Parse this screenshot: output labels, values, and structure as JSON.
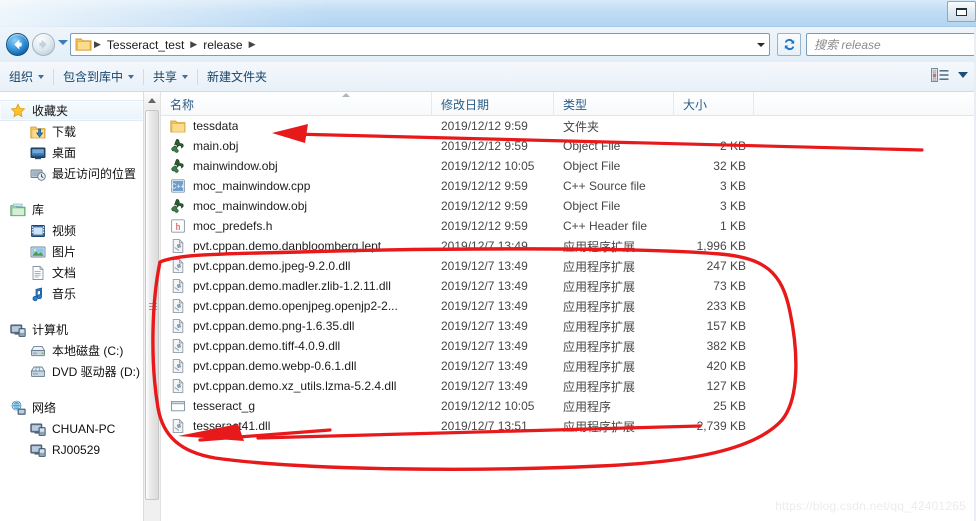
{
  "window": {
    "minimize_button_label": "",
    "restore_glyph": "restore-icon"
  },
  "navigation": {
    "back_label": "后退",
    "forward_label": "前进",
    "recent_pages_label": "最近的页面",
    "refresh_label": "刷新",
    "address_dropdown_label": "▼",
    "breadcrumbs": [
      {
        "label": "Tesseract_test"
      },
      {
        "label": "release"
      }
    ],
    "separator": "▶"
  },
  "search": {
    "placeholder": "搜索 release",
    "value": ""
  },
  "command_bar": {
    "items": [
      {
        "label": "组织",
        "has_caret": true
      },
      {
        "label": "包含到库中",
        "has_caret": true
      },
      {
        "label": "共享",
        "has_caret": true
      },
      {
        "label": "新建文件夹",
        "has_caret": false
      }
    ],
    "view_button_label": "更改您的视图",
    "help_label": ""
  },
  "sidebar": {
    "groups": [
      {
        "root": {
          "label": "收藏夹",
          "icon": "star-icon",
          "selected": true
        },
        "children": [
          {
            "label": "下载",
            "icon": "download-folder-icon"
          },
          {
            "label": "桌面",
            "icon": "desktop-icon"
          },
          {
            "label": "最近访问的位置",
            "icon": "recent-places-icon"
          }
        ]
      },
      {
        "root": {
          "label": "库",
          "icon": "library-icon",
          "selected": false
        },
        "children": [
          {
            "label": "视频",
            "icon": "video-icon"
          },
          {
            "label": "图片",
            "icon": "picture-icon"
          },
          {
            "label": "文档",
            "icon": "document-icon"
          },
          {
            "label": "音乐",
            "icon": "music-icon"
          }
        ]
      },
      {
        "root": {
          "label": "计算机",
          "icon": "computer-icon",
          "selected": false
        },
        "children": [
          {
            "label": "本地磁盘 (C:)",
            "icon": "hard-disk-icon"
          },
          {
            "label": "DVD 驱动器 (D:)",
            "icon": "dvd-drive-icon"
          }
        ]
      },
      {
        "root": {
          "label": "网络",
          "icon": "network-icon",
          "selected": false
        },
        "children": [
          {
            "label": "CHUAN-PC",
            "icon": "computer-icon"
          },
          {
            "label": "RJ00529",
            "icon": "computer-icon"
          }
        ]
      }
    ]
  },
  "file_list": {
    "columns": [
      {
        "key": "name",
        "label": "名称",
        "sorted": true
      },
      {
        "key": "date",
        "label": "修改日期",
        "sorted": false
      },
      {
        "key": "type",
        "label": "类型",
        "sorted": false
      },
      {
        "key": "size",
        "label": "大小",
        "sorted": false
      }
    ],
    "rows": [
      {
        "name": "tessdata",
        "date": "2019/12/12 9:59",
        "type": "文件夹",
        "size": "",
        "icon": "folder-icon"
      },
      {
        "name": "main.obj",
        "date": "2019/12/12 9:59",
        "type": "Object File",
        "size": "2 KB",
        "icon": "obj-file-icon"
      },
      {
        "name": "mainwindow.obj",
        "date": "2019/12/12 10:05",
        "type": "Object File",
        "size": "32 KB",
        "icon": "obj-file-icon"
      },
      {
        "name": "moc_mainwindow.cpp",
        "date": "2019/12/12 9:59",
        "type": "C++ Source file",
        "size": "3 KB",
        "icon": "cpp-source-icon"
      },
      {
        "name": "moc_mainwindow.obj",
        "date": "2019/12/12 9:59",
        "type": "Object File",
        "size": "3 KB",
        "icon": "obj-file-icon"
      },
      {
        "name": "moc_predefs.h",
        "date": "2019/12/12 9:59",
        "type": "C++ Header file",
        "size": "1 KB",
        "icon": "header-file-icon"
      },
      {
        "name": "pvt.cppan.demo.danbloomberg.lept...",
        "date": "2019/12/7 13:49",
        "type": "应用程序扩展",
        "size": "1,996 KB",
        "icon": "dll-icon"
      },
      {
        "name": "pvt.cppan.demo.jpeg-9.2.0.dll",
        "date": "2019/12/7 13:49",
        "type": "应用程序扩展",
        "size": "247 KB",
        "icon": "dll-icon"
      },
      {
        "name": "pvt.cppan.demo.madler.zlib-1.2.11.dll",
        "date": "2019/12/7 13:49",
        "type": "应用程序扩展",
        "size": "73 KB",
        "icon": "dll-icon"
      },
      {
        "name": "pvt.cppan.demo.openjpeg.openjp2-2...",
        "date": "2019/12/7 13:49",
        "type": "应用程序扩展",
        "size": "233 KB",
        "icon": "dll-icon"
      },
      {
        "name": "pvt.cppan.demo.png-1.6.35.dll",
        "date": "2019/12/7 13:49",
        "type": "应用程序扩展",
        "size": "157 KB",
        "icon": "dll-icon"
      },
      {
        "name": "pvt.cppan.demo.tiff-4.0.9.dll",
        "date": "2019/12/7 13:49",
        "type": "应用程序扩展",
        "size": "382 KB",
        "icon": "dll-icon"
      },
      {
        "name": "pvt.cppan.demo.webp-0.6.1.dll",
        "date": "2019/12/7 13:49",
        "type": "应用程序扩展",
        "size": "420 KB",
        "icon": "dll-icon"
      },
      {
        "name": "pvt.cppan.demo.xz_utils.lzma-5.2.4.dll",
        "date": "2019/12/7 13:49",
        "type": "应用程序扩展",
        "size": "127 KB",
        "icon": "dll-icon"
      },
      {
        "name": "tesseract_g",
        "date": "2019/12/12 10:05",
        "type": "应用程序",
        "size": "25 KB",
        "icon": "exe-icon"
      },
      {
        "name": "tesseract41.dll",
        "date": "2019/12/7 13:51",
        "type": "应用程序扩展",
        "size": "2,739 KB",
        "icon": "dll-icon"
      }
    ]
  },
  "annotations": {
    "color": "#e8191b",
    "items": [
      {
        "name": "arrow-to-tessdata",
        "kind": "arrow"
      },
      {
        "name": "arrow-to-tesseract-exe",
        "kind": "arrow"
      },
      {
        "name": "ellipse-around-dlls",
        "kind": "ellipse"
      }
    ]
  },
  "watermark": {
    "text": "https://blog.csdn.net/qq_42401265"
  }
}
